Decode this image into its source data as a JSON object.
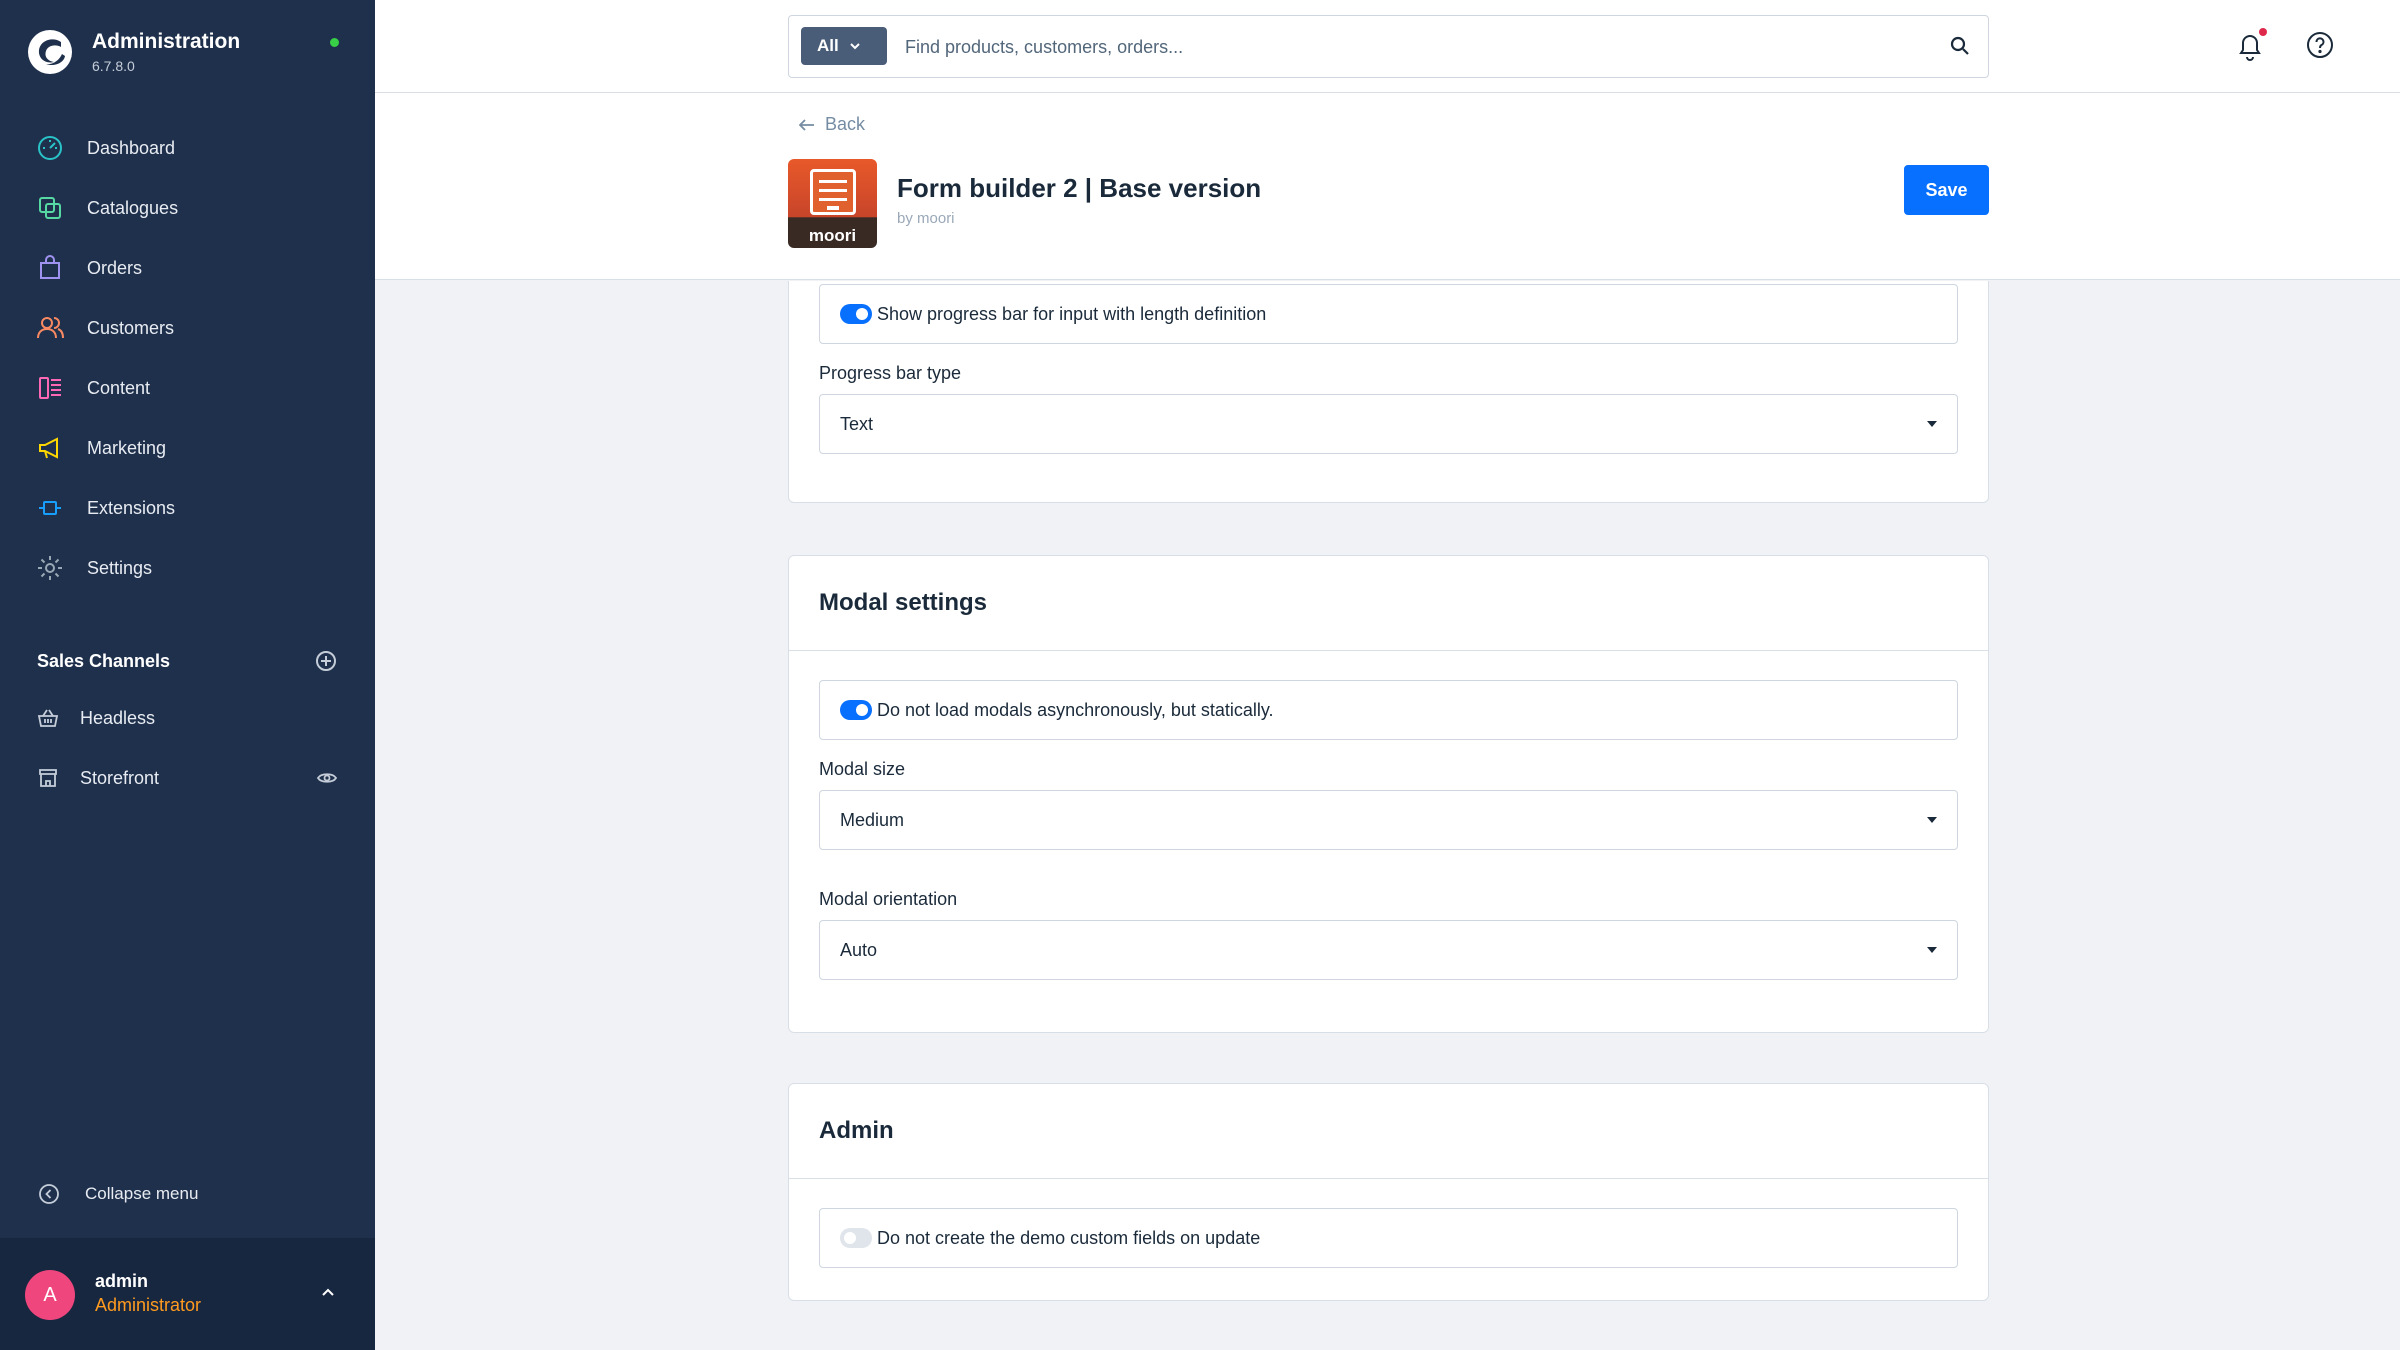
{
  "sidebar": {
    "brand_title": "Administration",
    "brand_version": "6.7.8.0",
    "nav": [
      {
        "label": "Dashboard",
        "icon": "dashboard-icon",
        "color": "#29c3c8"
      },
      {
        "label": "Catalogues",
        "icon": "catalogue-icon",
        "color": "#57d9a3"
      },
      {
        "label": "Orders",
        "icon": "orders-icon",
        "color": "#a092f0"
      },
      {
        "label": "Customers",
        "icon": "customers-icon",
        "color": "#f88962"
      },
      {
        "label": "Content",
        "icon": "content-icon",
        "color": "#ff68b4"
      },
      {
        "label": "Marketing",
        "icon": "marketing-icon",
        "color": "#ffd700"
      },
      {
        "label": "Extensions",
        "icon": "extensions-icon",
        "color": "#189eff"
      },
      {
        "label": "Settings",
        "icon": "settings-icon",
        "color": "#9aa8b5"
      }
    ],
    "sales_channels_title": "Sales Channels",
    "sales_channels": [
      {
        "label": "Headless",
        "icon": "basket-icon"
      },
      {
        "label": "Storefront",
        "icon": "storefront-icon"
      }
    ],
    "collapse_label": "Collapse menu",
    "user": {
      "initial": "A",
      "name": "admin",
      "role": "Administrator"
    }
  },
  "topbar": {
    "search_type": "All",
    "search_placeholder": "Find products, customers, orders..."
  },
  "header": {
    "back_label": "Back",
    "plugin_brand": "moori",
    "plugin_title": "Form builder 2 | Base version",
    "plugin_by": "by moori",
    "save_label": "Save"
  },
  "sections": {
    "progress": {
      "toggle_label": "Show progress bar for input with length definition",
      "toggle_on": true,
      "type_label": "Progress bar type",
      "type_value": "Text"
    },
    "modal": {
      "title": "Modal settings",
      "toggle_label": "Do not load modals asynchronously, but statically.",
      "toggle_on": true,
      "size_label": "Modal size",
      "size_value": "Medium",
      "orientation_label": "Modal orientation",
      "orientation_value": "Auto"
    },
    "admin": {
      "title": "Admin",
      "toggle_label": "Do not create the demo custom fields on update",
      "toggle_on": false
    }
  },
  "colors": {
    "sidebar_bg": "#1f304c",
    "primary": "#0870ff",
    "status_online": "#37d046",
    "role_color": "#ff9b1f",
    "avatar_bg": "#f0467e"
  }
}
